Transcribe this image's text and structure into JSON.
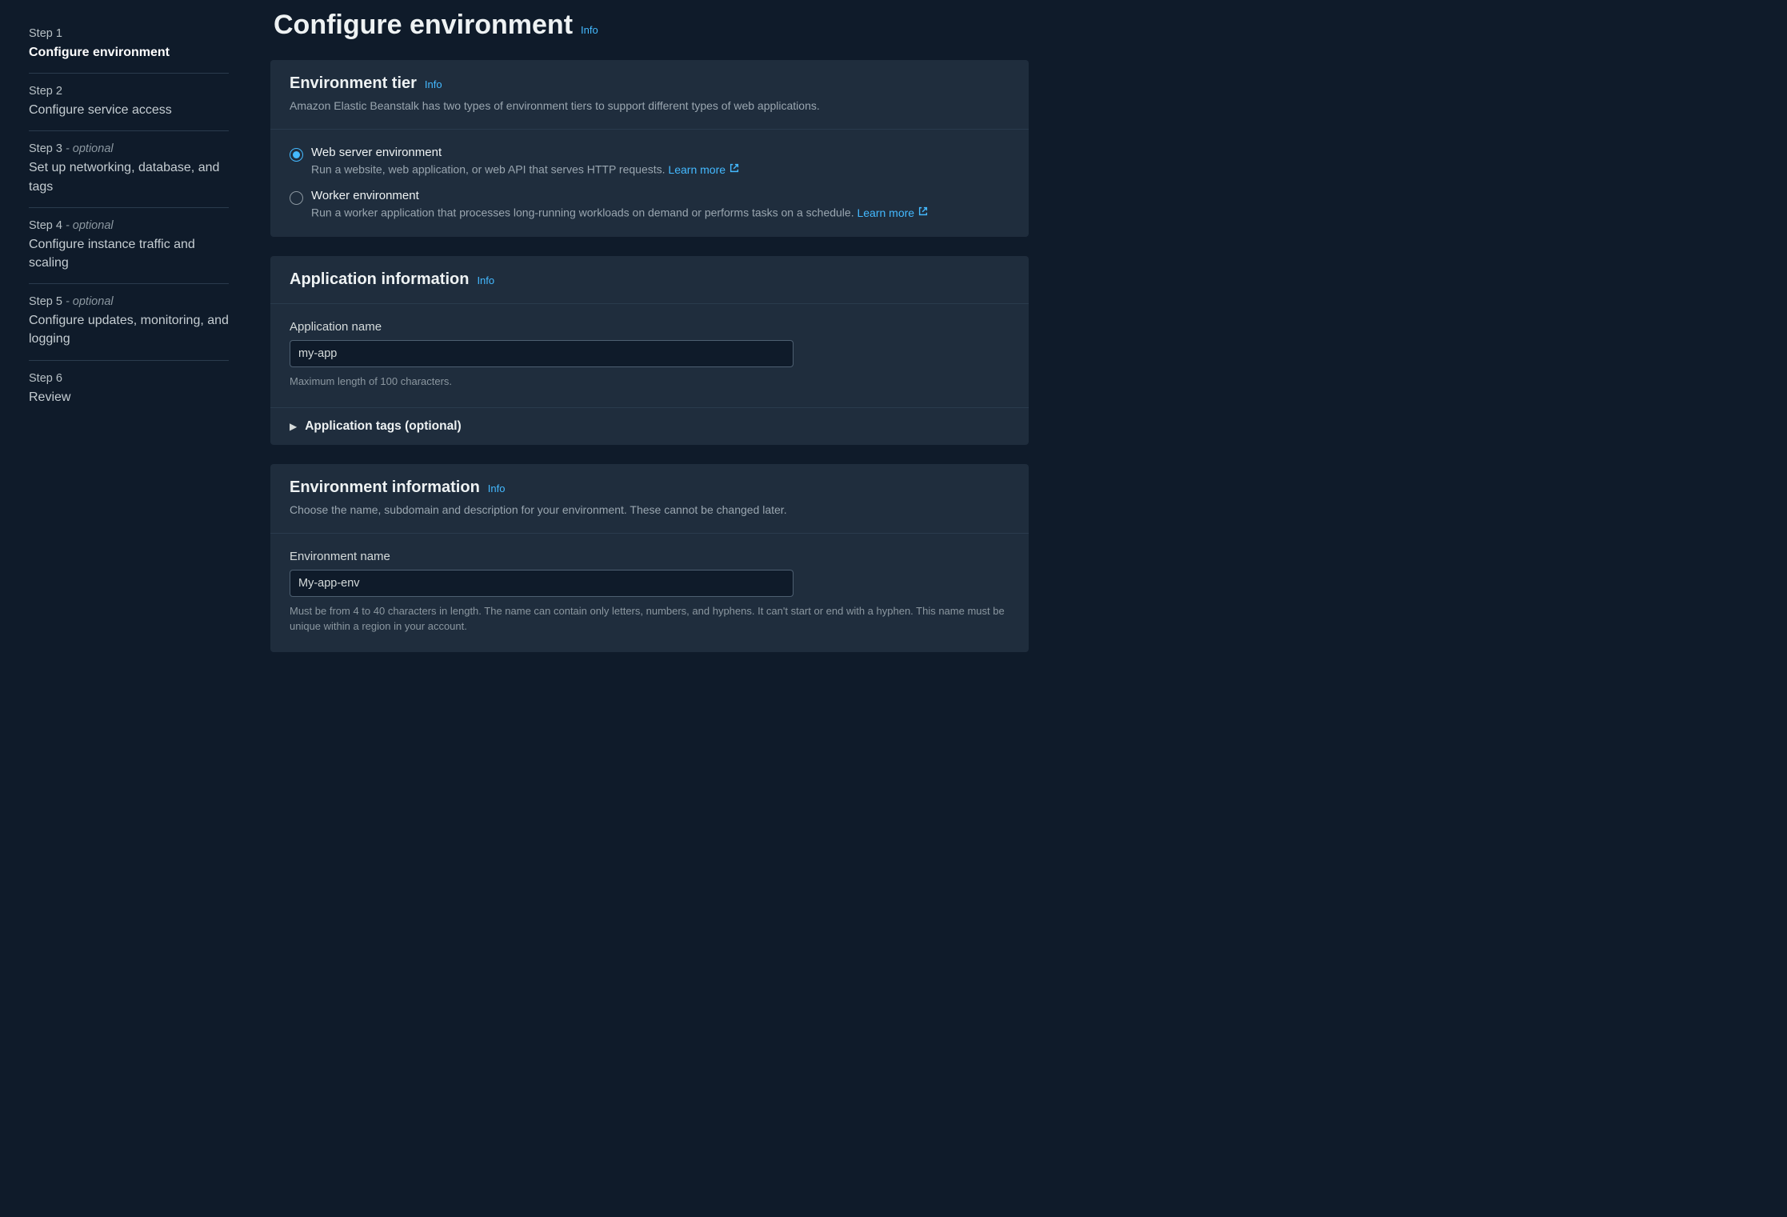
{
  "sidebar": {
    "steps": [
      {
        "label": "Step 1",
        "optional": "",
        "title": "Configure environment",
        "active": true
      },
      {
        "label": "Step 2",
        "optional": "",
        "title": "Configure service access",
        "active": false
      },
      {
        "label": "Step 3",
        "optional": " - optional",
        "title": "Set up networking, database, and tags",
        "active": false
      },
      {
        "label": "Step 4",
        "optional": " - optional",
        "title": "Configure instance traffic and scaling",
        "active": false
      },
      {
        "label": "Step 5",
        "optional": " - optional",
        "title": "Configure updates, monitoring, and logging",
        "active": false
      },
      {
        "label": "Step 6",
        "optional": "",
        "title": "Review",
        "active": false
      }
    ]
  },
  "page": {
    "title": "Configure environment",
    "info": "Info"
  },
  "env_tier": {
    "title": "Environment tier",
    "info": "Info",
    "subtitle": "Amazon Elastic Beanstalk has two types of environment tiers to support different types of web applications.",
    "options": [
      {
        "label": "Web server environment",
        "desc": "Run a website, web application, or web API that serves HTTP requests. ",
        "learn": "Learn more",
        "checked": true
      },
      {
        "label": "Worker environment",
        "desc": "Run a worker application that processes long-running workloads on demand or performs tasks on a schedule. ",
        "learn": "Learn more",
        "checked": false
      }
    ]
  },
  "app_info": {
    "title": "Application information",
    "info": "Info",
    "name_label": "Application name",
    "name_value": "my-app",
    "name_helper": "Maximum length of 100 characters.",
    "tags_label": "Application tags (optional)"
  },
  "env_info": {
    "title": "Environment information",
    "info": "Info",
    "subtitle": "Choose the name, subdomain and description for your environment. These cannot be changed later.",
    "name_label": "Environment name",
    "name_value": "My-app-env",
    "name_helper": "Must be from 4 to 40 characters in length. The name can contain only letters, numbers, and hyphens. It can't start or end with a hyphen. This name must be unique within a region in your account."
  }
}
